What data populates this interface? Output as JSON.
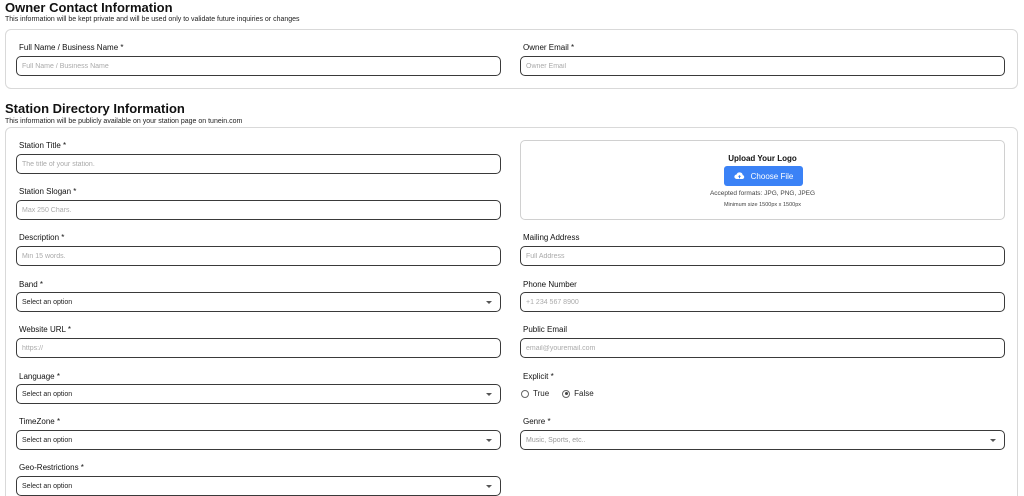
{
  "owner": {
    "title": "Owner Contact Information",
    "subtitle": "This information will be kept private and will be used only to validate future inquiries or changes",
    "full_name_label": "Full Name / Business Name *",
    "full_name_placeholder": "Full Name / Business Name",
    "email_label": "Owner Email *",
    "email_placeholder": "Owner Email"
  },
  "station": {
    "title": "Station Directory Information",
    "subtitle": "This information will be publicly available on your station page on tunein.com",
    "station_title_label": "Station Title *",
    "station_title_placeholder": "The title of your station.",
    "slogan_label": "Station Slogan *",
    "slogan_placeholder": "Max 250 Chars.",
    "description_label": "Description *",
    "description_placeholder": "Min 15 words.",
    "band_label": "Band *",
    "band_value": "Select an option",
    "website_label": "Website URL *",
    "website_placeholder": "https://",
    "language_label": "Language *",
    "language_value": "Select an option",
    "timezone_label": "TimeZone *",
    "timezone_value": "Select an option",
    "geo_label": "Geo-Restrictions *",
    "geo_value": "Select an option",
    "mailing_label": "Mailing Address",
    "mailing_placeholder": "Full Address",
    "phone_label": "Phone Number",
    "phone_placeholder": "+1 234 567 8900",
    "public_email_label": "Public Email",
    "public_email_placeholder": "email@youremail.com",
    "explicit_label": "Explicit *",
    "explicit_true": "True",
    "explicit_false": "False",
    "explicit_selected": "False",
    "genre_label": "Genre *",
    "genre_placeholder": "Music, Sports, etc..",
    "upload": {
      "title": "Upload Your Logo",
      "button": "Choose File",
      "icon": "cloud-upload-icon",
      "formats": "Accepted formats: JPG, PNG, JPEG",
      "min_size": "Minimum size 1500px x 1500px"
    }
  },
  "colors": {
    "accent": "#3b82f6"
  }
}
